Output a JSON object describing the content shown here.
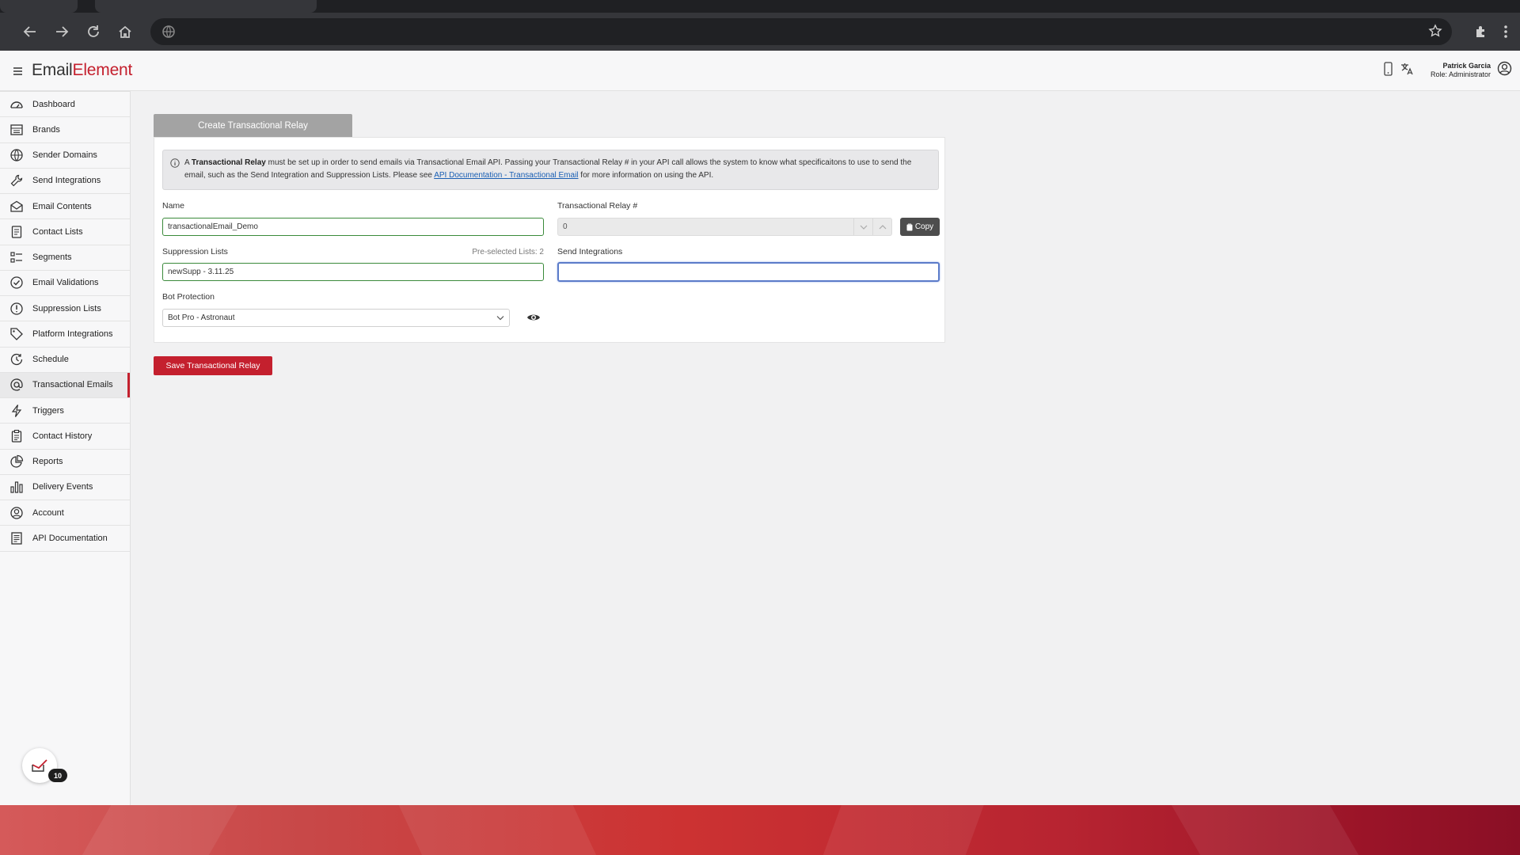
{
  "browser": {
    "icons": [
      "back-icon",
      "forward-icon",
      "reload-icon",
      "home-icon",
      "site-info-icon",
      "bookmark-star-icon",
      "extensions-icon",
      "menu-kebab-icon"
    ]
  },
  "header": {
    "logo_part1": "Em",
    "logo_part2": "ail",
    "logo_part3": "Element",
    "user_name": "Patrick Garcia",
    "user_role": "Role: Administrator"
  },
  "sidebar": {
    "items": [
      {
        "label": "Dashboard",
        "icon": "dashboard-icon"
      },
      {
        "label": "Brands",
        "icon": "brands-icon"
      },
      {
        "label": "Sender Domains",
        "icon": "globe-icon"
      },
      {
        "label": "Send Integrations",
        "icon": "wrench-icon"
      },
      {
        "label": "Email Contents",
        "icon": "envelope-icon"
      },
      {
        "label": "Contact Lists",
        "icon": "contact-list-icon"
      },
      {
        "label": "Segments",
        "icon": "segments-icon"
      },
      {
        "label": "Email Validations",
        "icon": "check-circle-icon"
      },
      {
        "label": "Suppression Lists",
        "icon": "exclamation-circle-icon"
      },
      {
        "label": "Platform Integrations",
        "icon": "tag-icon"
      },
      {
        "label": "Schedule",
        "icon": "schedule-icon"
      },
      {
        "label": "Transactional Emails",
        "icon": "at-sign-icon",
        "active": true
      },
      {
        "label": "Triggers",
        "icon": "lightning-icon"
      },
      {
        "label": "Contact History",
        "icon": "clipboard-icon"
      },
      {
        "label": "Reports",
        "icon": "pie-chart-icon"
      },
      {
        "label": "Delivery Events",
        "icon": "bar-chart-icon"
      },
      {
        "label": "Account",
        "icon": "user-circle-icon"
      },
      {
        "label": "API Documentation",
        "icon": "document-icon"
      }
    ],
    "notification_count": "10"
  },
  "form": {
    "tab_title": "Create Transactional Relay",
    "info": {
      "prefix": "A",
      "bold": "Transactional Relay",
      "text1": "must be set up in order to send emails via Transactional Email API. Passing your Transactional Relay # in your API call allows the system to know what specificaitons to use to send the email, such as the Send Integration and Suppression Lists. Please see",
      "link": "API Documentation - Transactional Email",
      "text2": "for more information on using the API."
    },
    "name_label": "Name",
    "name_value": "transactionalEmail_Demo",
    "relay_label": "Transactional Relay #",
    "relay_value": "0",
    "copy_label": "Copy",
    "suppression_label": "Suppression Lists",
    "preselected": "Pre-selected Lists: 2",
    "suppression_value": "newSupp - 3.11.25",
    "send_integrations_label": "Send Integrations",
    "send_integrations_value": "",
    "bot_label": "Bot Protection",
    "bot_value": "Bot Pro - Astronaut",
    "save_label": "Save Transactional Relay"
  },
  "colors": {
    "brand_red": "#c4202e",
    "valid_green": "#3a8a3a",
    "focus_blue": "#5b7bc9"
  }
}
